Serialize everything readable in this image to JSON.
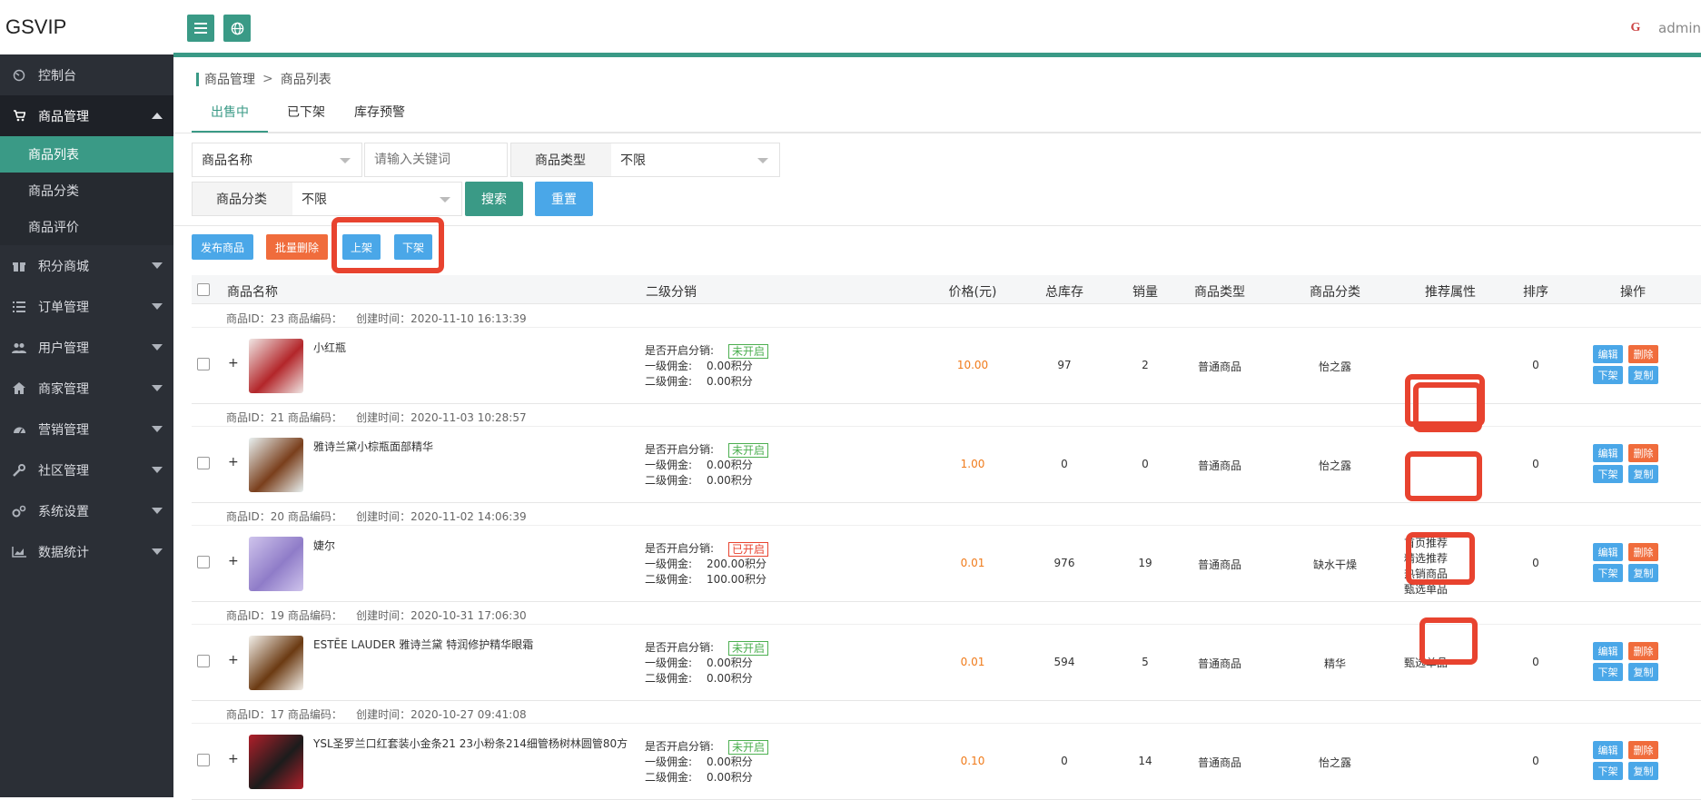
{
  "app": {
    "brand": "GSVIP",
    "user": "admin",
    "logo_text": "G"
  },
  "sidebar": {
    "items": [
      {
        "label": "控制台",
        "icon": "dashboard-icon"
      },
      {
        "label": "商品管理",
        "icon": "cart-icon",
        "expanded": true
      },
      {
        "label": "积分商城",
        "icon": "gift-icon"
      },
      {
        "label": "订单管理",
        "icon": "list-icon"
      },
      {
        "label": "用户管理",
        "icon": "users-icon"
      },
      {
        "label": "商家管理",
        "icon": "home-icon"
      },
      {
        "label": "营销管理",
        "icon": "gauge-icon"
      },
      {
        "label": "社区管理",
        "icon": "wrench-icon"
      },
      {
        "label": "系统设置",
        "icon": "gears-icon"
      },
      {
        "label": "数据统计",
        "icon": "chart-icon"
      }
    ],
    "sub_items": [
      {
        "label": "商品列表",
        "active": true
      },
      {
        "label": "商品分类"
      },
      {
        "label": "商品评价"
      }
    ]
  },
  "breadcrumb": {
    "parent": "商品管理",
    "sep": ">",
    "current": "商品列表"
  },
  "tabs": [
    "出售中",
    "已下架",
    "库存预警"
  ],
  "filters": {
    "field_select": "商品名称",
    "keyword_placeholder": "请输入关键词",
    "type_label": "商品类型",
    "type_value": "不限",
    "category_label": "商品分类",
    "category_value": "不限",
    "search_label": "搜索",
    "reset_label": "重置"
  },
  "actions": {
    "publish": "发布商品",
    "batch_delete": "批量删除",
    "on_shelf": "上架",
    "off_shelf": "下架"
  },
  "table": {
    "headers": {
      "name": "商品名称",
      "dist": "二级分销",
      "price": "价格(元)",
      "stock": "总库存",
      "sales": "销量",
      "type": "商品类型",
      "category": "商品分类",
      "recommend": "推荐属性",
      "sort": "排序",
      "ops": "操作"
    },
    "dist_labels": {
      "enabled": "是否开启分销:",
      "level1": "一级佣金:",
      "level2": "二级佣金:"
    },
    "op_labels": {
      "edit": "编辑",
      "delete": "删除",
      "off": "下架",
      "copy": "复制"
    },
    "rows": [
      {
        "meta_id": "商品ID：23 商品编码：",
        "meta_time": "创建时间：2020-11-10 16:13:39",
        "plus": "+",
        "name": "小红瓶",
        "dist_status": "未开启",
        "dist_on": false,
        "level1": "0.00积分",
        "level2": "0.00积分",
        "price": "10.00",
        "stock": "97",
        "sales": "2",
        "type": "普通商品",
        "category": "怡之露",
        "recommend": [],
        "sort": "0",
        "thumb": [
          "#b3262a",
          "#f0e6e4"
        ]
      },
      {
        "meta_id": "商品ID：21 商品编码：",
        "meta_time": "创建时间：2020-11-03 10:28:57",
        "plus": "+",
        "name": "雅诗兰黛小棕瓶面部精华",
        "dist_status": "未开启",
        "dist_on": false,
        "level1": "0.00积分",
        "level2": "0.00积分",
        "price": "1.00",
        "stock": "0",
        "sales": "0",
        "type": "普通商品",
        "category": "怡之露",
        "recommend": [],
        "sort": "0",
        "thumb": [
          "#7a3f1c",
          "#e9f1f1"
        ]
      },
      {
        "meta_id": "商品ID：20 商品编码：",
        "meta_time": "创建时间：2020-11-02 14:06:39",
        "plus": "+",
        "name": "婕尔",
        "dist_status": "已开启",
        "dist_on": true,
        "level1": "200.00积分",
        "level2": "100.00积分",
        "price": "0.01",
        "stock": "976",
        "sales": "19",
        "type": "普通商品",
        "category": "缺水干燥",
        "recommend": [
          "首页推荐",
          "精选推荐",
          "热销商品",
          "甄选单品"
        ],
        "sort": "0",
        "thumb": [
          "#8f7cc8",
          "#cfc4ec"
        ]
      },
      {
        "meta_id": "商品ID：19 商品编码：",
        "meta_time": "创建时间：2020-10-31 17:06:30",
        "plus": "+",
        "name": "ESTĒE LAUDER 雅诗兰黛 特润修护精华眼霜",
        "dist_status": "未开启",
        "dist_on": false,
        "level1": "0.00积分",
        "level2": "0.00积分",
        "price": "0.01",
        "stock": "594",
        "sales": "5",
        "type": "普通商品",
        "category": "精华",
        "recommend": [
          "甄选单品"
        ],
        "sort": "0",
        "thumb": [
          "#6b3a12",
          "#f3f0ea"
        ]
      },
      {
        "meta_id": "商品ID：17 商品编码：",
        "meta_time": "创建时间：2020-10-27 09:41:08",
        "plus": "+",
        "name": "YSL圣罗兰口红套装小金条21 23小粉条214细管杨树林圆管80方",
        "dist_status": "未开启",
        "dist_on": false,
        "level1": "0.00积分",
        "level2": "0.00积分",
        "price": "0.10",
        "stock": "0",
        "sales": "14",
        "type": "普通商品",
        "category": "怡之露",
        "recommend": [],
        "sort": "0",
        "thumb": [
          "#1c1c1c",
          "#b01f2a"
        ]
      }
    ]
  },
  "colors": {
    "accent": "#3a9a86",
    "sidebar": "#2b2f36",
    "blue": "#4aa7e8",
    "orange": "#f06c3c",
    "price": "#f07b1b",
    "highlight": "#e8432f"
  }
}
